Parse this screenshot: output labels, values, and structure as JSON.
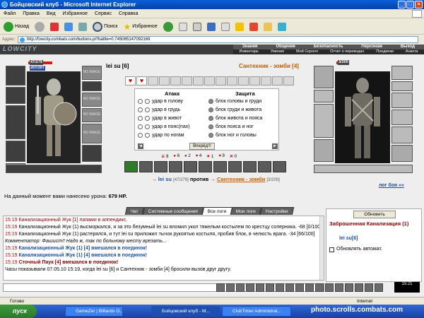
{
  "window": {
    "title": "Бойцовский клуб - Microsoft Internet Explorer"
  },
  "menu": [
    "Файл",
    "Правка",
    "Вид",
    "Избранное",
    "Сервис",
    "Справка"
  ],
  "toolbar": {
    "back": "Назад",
    "search": "Поиск",
    "favorites": "Избранное"
  },
  "address": {
    "label": "Адрес:",
    "url": "http://fowcity.combats.com/buttons.pl?battle=0.745085147092169"
  },
  "game": {
    "logo": "LOWCITY",
    "nav_top": [
      "Знания",
      "Общение",
      "Безопасность",
      "Персонаж",
      "Выход"
    ],
    "nav_bottom": [
      "Инвентарь",
      "Умения",
      "Мой Скролл",
      "Отчет о переводах",
      "Поединки",
      "Анкета"
    ]
  },
  "player": {
    "name": "lei su [6]",
    "hp": "47/279",
    "mana": "207/207"
  },
  "enemy": {
    "name": "Сантехник - зомби [4]",
    "hp": "3/200"
  },
  "slots": {
    "noimage": "NO IMAGE"
  },
  "combat": {
    "attack_header": "Атака",
    "defense_header": "Защита",
    "attacks": [
      "удар в голову",
      "удар в грудь",
      "удар в живот",
      "удар в пояс(пах)",
      "удар по ногам"
    ],
    "defenses": [
      "блок головы и груди",
      "блок груди и живота",
      "блок живота и пояса",
      "блок пояса и ног",
      "блок ног и головы"
    ],
    "go": "Вперёд!!!",
    "stats": [
      "8",
      "6",
      "2",
      "4",
      "1",
      "9",
      "0"
    ]
  },
  "versus": {
    "p1": "lei su",
    "p1hp": "[47/279]",
    "vs": "против",
    "p2": "Сантехник - зомби",
    "p2hp": "[3/200]"
  },
  "log_link": "лог боя »»",
  "damage": {
    "label": "На данный момент вами нанесено урона:",
    "value": "679 HP."
  },
  "tabs": [
    "Чат",
    "Системные сообщения",
    "Все логи",
    "Мои логи",
    "Настройки"
  ],
  "chat": [
    {
      "time": "15:19",
      "text": "Канализационный Жук [1] лапами в аппендикс."
    },
    {
      "time": "15:19",
      "text": "Канализационный Жук (1) высморкался, и за это безумный lei su вломил укол тяжелым костылем по крестцу соперника. -68 [0/100]"
    },
    {
      "time": "15:19",
      "text": "Канализационный Жук (1) растерялся, и тут lei su приложил тычок рукоятью костыля, пробив блок, в челюсть врага. -34 [66/100]"
    },
    {
      "time": "",
      "text": "Комментатор: Фашист!! Надо ж, так по больному месту врезать..."
    },
    {
      "time": "15:19",
      "text": "Канализационный Жук (1) [4] вмешался в поединок!"
    },
    {
      "time": "15:19",
      "text": "Канализационный Жук (1) [4] вмешался в поединок!"
    },
    {
      "time": "15:19",
      "text": "Сточный Паук [4] вмешался в поединок!"
    },
    {
      "time": "",
      "text": "Часы показывали 07.05.10 15:19, когда lei su [6] и Сантехник - зомби [4] бросили вызов друг другу."
    }
  ],
  "side": {
    "refresh": "Обновить",
    "location": "Заброшенная Канализация (1)",
    "online": "lei su[6]",
    "auto": "Обновлять автомат."
  },
  "clock": "15:21",
  "status": {
    "left": "Готово",
    "zone": "Internet"
  },
  "taskbar": {
    "start": "пуск",
    "tasks": [
      "GameZer | Billiards O...",
      "Бойцовский клуб - M...",
      "ClubTimer Administrat..."
    ]
  },
  "watermark": "photo.scrolls.combats.com",
  "colors": {
    "titlebar": "#0a5fd8",
    "taskbar": "#245edb",
    "start": "#3c9a3c",
    "enemy_link": "#c65a00",
    "hp": "#cc2020",
    "log_name": "#1d4fa4"
  }
}
